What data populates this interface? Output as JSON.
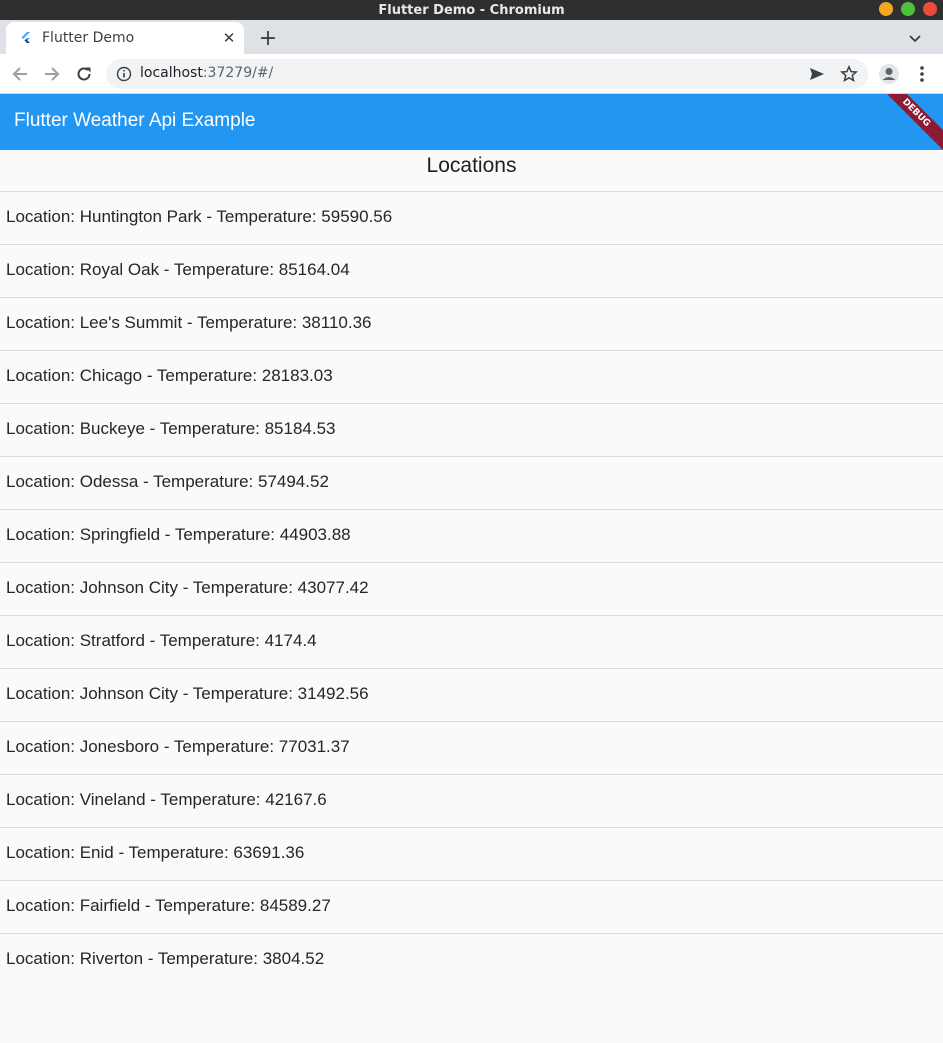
{
  "window": {
    "title": "Flutter Demo - Chromium"
  },
  "browser": {
    "tab": {
      "title": "Flutter Demo",
      "close_glyph": "✕"
    },
    "new_tab_glyph": "+",
    "url": {
      "host": "localhost",
      "rest": ":37279/#/"
    }
  },
  "appbar": {
    "title": "Flutter Weather Api Example",
    "debug_label": "DEBUG",
    "color": "#2196f3"
  },
  "main": {
    "heading": "Locations",
    "items": [
      {
        "label": "Location: Huntington Park - Temperature: 59590.56"
      },
      {
        "label": "Location: Royal Oak - Temperature: 85164.04"
      },
      {
        "label": "Location: Lee's Summit - Temperature: 38110.36"
      },
      {
        "label": "Location: Chicago - Temperature: 28183.03"
      },
      {
        "label": "Location: Buckeye - Temperature: 85184.53"
      },
      {
        "label": "Location: Odessa - Temperature: 57494.52"
      },
      {
        "label": "Location: Springfield - Temperature: 44903.88"
      },
      {
        "label": "Location: Johnson City - Temperature: 43077.42"
      },
      {
        "label": "Location: Stratford - Temperature: 4174.4"
      },
      {
        "label": "Location: Johnson City - Temperature: 31492.56"
      },
      {
        "label": "Location: Jonesboro - Temperature: 77031.37"
      },
      {
        "label": "Location: Vineland - Temperature: 42167.6"
      },
      {
        "label": "Location: Enid - Temperature: 63691.36"
      },
      {
        "label": "Location: Fairfield - Temperature: 84589.27"
      },
      {
        "label": "Location: Riverton - Temperature: 3804.52"
      }
    ]
  }
}
